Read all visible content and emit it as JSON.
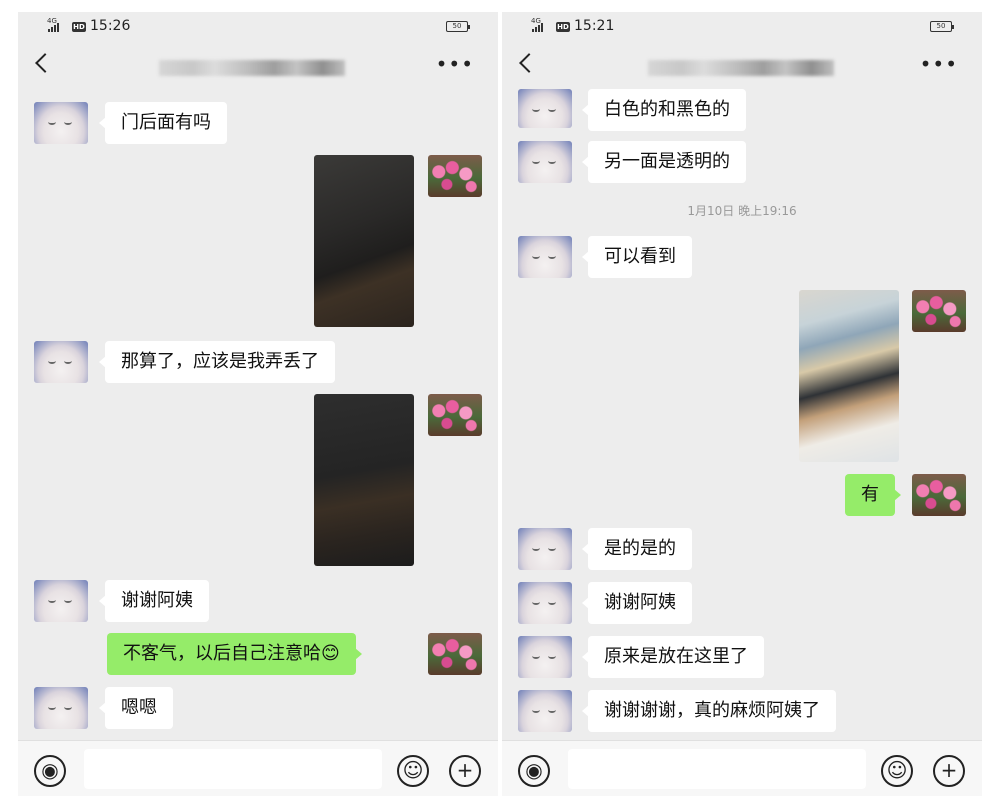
{
  "screens": [
    {
      "time": "15:26",
      "status": {
        "network": "4G",
        "hd": "HD",
        "battery": "50"
      },
      "messages": [
        {
          "dir": "in",
          "type": "text",
          "text": "门后面有吗"
        },
        {
          "dir": "out",
          "type": "image"
        },
        {
          "dir": "in",
          "type": "text",
          "text": "那算了，应该是我弄丢了"
        },
        {
          "dir": "out",
          "type": "image"
        },
        {
          "dir": "in",
          "type": "text",
          "text": "谢谢阿姨"
        },
        {
          "dir": "out",
          "type": "text",
          "text": "不客气，以后自己注意哈😊"
        },
        {
          "dir": "in",
          "type": "text",
          "text": "嗯嗯"
        }
      ]
    },
    {
      "time": "15:21",
      "status": {
        "network": "4G",
        "hd": "HD",
        "battery": "50"
      },
      "timestamp": "1月10日  晚上19:16",
      "messages": [
        {
          "dir": "in",
          "type": "text",
          "text": "白色的和黑色的"
        },
        {
          "dir": "in",
          "type": "text",
          "text": "另一面是透明的"
        },
        {
          "dir": "in",
          "type": "text",
          "text": "可以看到"
        },
        {
          "dir": "out",
          "type": "image"
        },
        {
          "dir": "out",
          "type": "text",
          "text": "有"
        },
        {
          "dir": "in",
          "type": "text",
          "text": "是的是的"
        },
        {
          "dir": "in",
          "type": "text",
          "text": "谢谢阿姨"
        },
        {
          "dir": "in",
          "type": "text",
          "text": "原来是放在这里了"
        },
        {
          "dir": "in",
          "type": "text",
          "text": "谢谢谢谢，真的麻烦阿姨了"
        }
      ]
    }
  ],
  "icons": {
    "back": "chevron-left-icon",
    "more": "more-dots-icon",
    "voice": "voice-icon",
    "emoji": "emoji-icon",
    "plus": "plus-icon",
    "avatar_contact": "cat-avatar",
    "avatar_self": "flower-avatar"
  },
  "colors": {
    "chat_background": "#ededed",
    "outgoing_bubble": "#95ec69",
    "incoming_bubble": "#ffffff"
  }
}
